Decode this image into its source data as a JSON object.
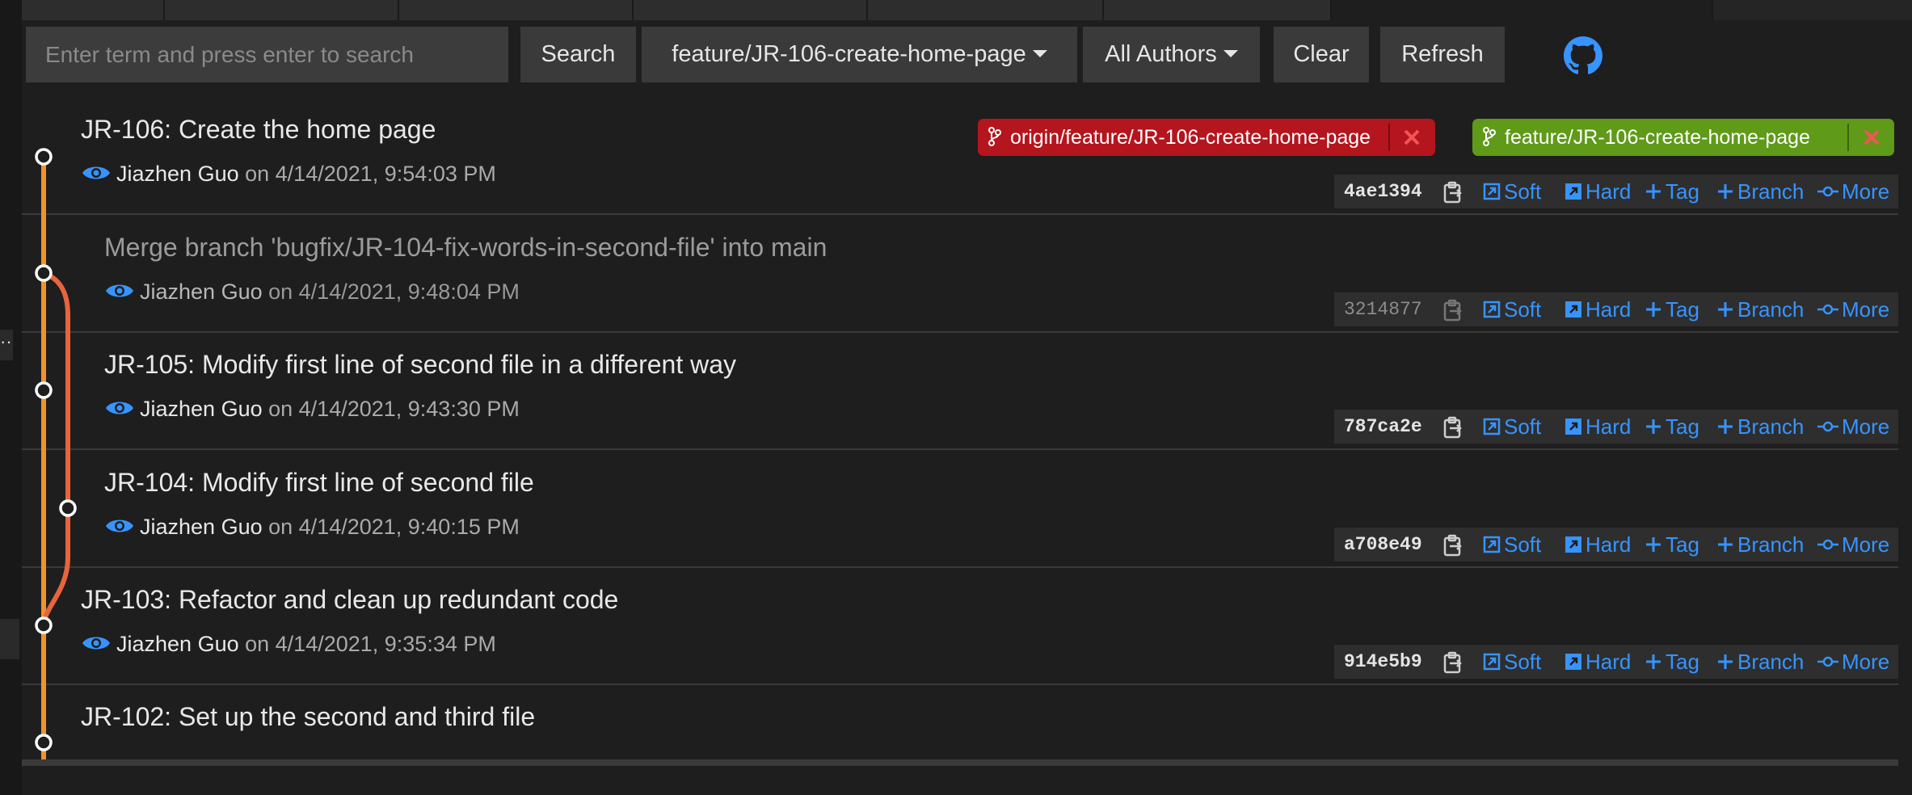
{
  "toolbar": {
    "search_placeholder": "Enter term and press enter to search",
    "search_label": "Search",
    "branch_label": "feature/JR-106-create-home-page",
    "authors_label": "All Authors",
    "clear_label": "Clear",
    "refresh_label": "Refresh"
  },
  "refs": {
    "remote": "origin/feature/JR-106-create-home-page",
    "local": "feature/JR-106-create-home-page"
  },
  "actions": {
    "soft": "Soft",
    "hard": "Hard",
    "tag": "Tag",
    "branch": "Branch",
    "more": "More"
  },
  "colors": {
    "accent": "#3794ff",
    "graph_main": "#f0932b",
    "graph_merge": "#e8643c",
    "remote_ref": "#b5151d",
    "local_ref": "#5f9a18",
    "ref_close": "#f25555"
  },
  "commits": [
    {
      "message": "JR-106: Create the home page",
      "author": "Jiazhen Guo",
      "date": "on 4/14/2021, 9:54:03 PM",
      "hash": "4ae1394"
    },
    {
      "message": "Merge branch 'bugfix/JR-104-fix-words-in-second-file' into main",
      "author": "Jiazhen Guo",
      "date": "on 4/14/2021, 9:48:04 PM",
      "hash": "3214877"
    },
    {
      "message": "JR-105: Modify first line of second file in a different way",
      "author": "Jiazhen Guo",
      "date": "on 4/14/2021, 9:43:30 PM",
      "hash": "787ca2e"
    },
    {
      "message": "JR-104: Modify first line of second file",
      "author": "Jiazhen Guo",
      "date": "on 4/14/2021, 9:40:15 PM",
      "hash": "a708e49"
    },
    {
      "message": "JR-103: Refactor and clean up redundant code",
      "author": "Jiazhen Guo",
      "date": "on 4/14/2021, 9:35:34 PM",
      "hash": "914e5b9"
    },
    {
      "message": "JR-102: Set up the second and third file"
    }
  ]
}
